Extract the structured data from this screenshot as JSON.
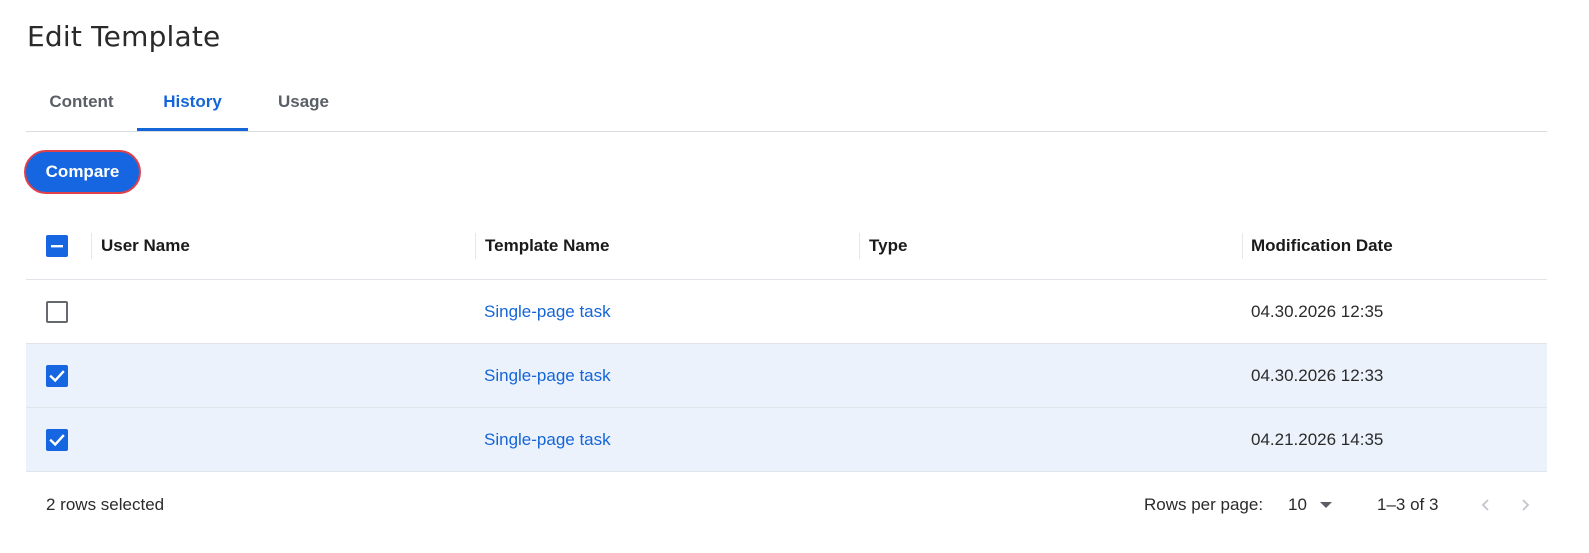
{
  "page_title": "Edit Template",
  "tabs": [
    {
      "label": "Content",
      "active": false
    },
    {
      "label": "History",
      "active": true
    },
    {
      "label": "Usage",
      "active": false
    }
  ],
  "toolbar": {
    "compare_label": "Compare"
  },
  "table": {
    "headers": {
      "user_name": "User Name",
      "template_name": "Template Name",
      "type": "Type",
      "modification_date": "Modification Date"
    },
    "select_all_state": "indeterminate",
    "rows": [
      {
        "selected": false,
        "user_name": "",
        "template_name": "Single-page task",
        "type": "",
        "modification_date": "04.30.2026 12:35"
      },
      {
        "selected": true,
        "user_name": "",
        "template_name": "Single-page task",
        "type": "",
        "modification_date": "04.30.2026 12:33"
      },
      {
        "selected": true,
        "user_name": "",
        "template_name": "Single-page task",
        "type": "",
        "modification_date": "04.21.2026 14:35"
      }
    ]
  },
  "footer": {
    "selection_text": "2 rows selected",
    "rows_per_page_label": "Rows per page:",
    "rows_per_page_value": "10",
    "range_text": "1–3 of 3"
  },
  "colors": {
    "accent": "#1566e0",
    "link": "#1565d8",
    "selected_row_bg": "#ebf2fb",
    "focus_ring": "#e0404a"
  },
  "icons": {
    "select_all": "minus-checkbox-icon",
    "row_checked": "check-icon",
    "rows_per_page": "caret-down-icon",
    "prev": "chevron-left-icon",
    "next": "chevron-right-icon"
  }
}
